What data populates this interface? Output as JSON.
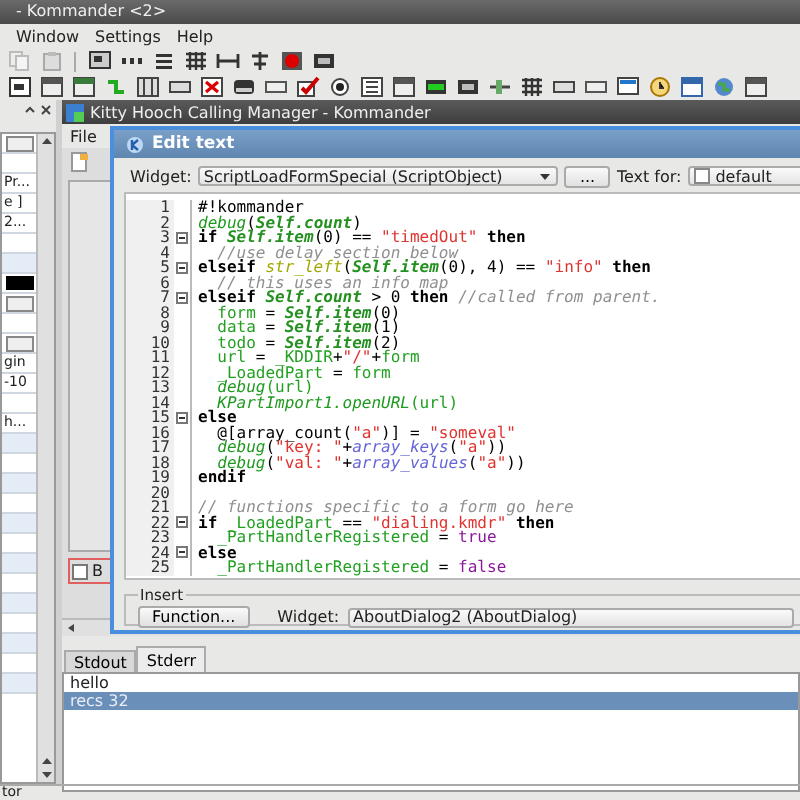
{
  "window": {
    "title": "- Kommander <2>"
  },
  "menu": [
    "Window",
    "Settings",
    "Help"
  ],
  "dock_panel": {
    "rows": [
      {
        "kind": "field"
      },
      {
        "kind": "blank"
      },
      {
        "kind": "text",
        "text": "Pr..."
      },
      {
        "kind": "text",
        "text": "e ]"
      },
      {
        "kind": "text",
        "text": "2..."
      },
      {
        "kind": "blank"
      },
      {
        "kind": "shaded"
      },
      {
        "kind": "black"
      },
      {
        "kind": "field"
      },
      {
        "kind": "blank"
      },
      {
        "kind": "field"
      },
      {
        "kind": "text",
        "text": "gin"
      },
      {
        "kind": "text",
        "text": "-10"
      },
      {
        "kind": "blank"
      },
      {
        "kind": "text",
        "text": "h..."
      },
      {
        "kind": "shaded"
      },
      {
        "kind": "blank"
      },
      {
        "kind": "shaded"
      },
      {
        "kind": "blank"
      },
      {
        "kind": "shaded"
      },
      {
        "kind": "blank"
      },
      {
        "kind": "shaded"
      },
      {
        "kind": "blank"
      },
      {
        "kind": "shaded"
      },
      {
        "kind": "blank"
      },
      {
        "kind": "shaded"
      },
      {
        "kind": "blank"
      },
      {
        "kind": "shaded"
      }
    ]
  },
  "inner_window": {
    "title": "Kitty Hooch Calling Manager - Kommander",
    "menu": [
      "File"
    ],
    "checkbox": {
      "label": "B",
      "checked": false
    }
  },
  "dialog": {
    "title": "Edit text",
    "widget_label": "Widget:",
    "widget_value": "ScriptLoadFormSpecial (ScriptObject)",
    "browse_button": "...",
    "text_for_label": "Text for:",
    "text_for_value": "default",
    "code_lines": [
      {
        "number": "1",
        "fold": false,
        "tokens": [
          {
            "kind": "plain",
            "text": "#!kommander"
          }
        ]
      },
      {
        "number": "2",
        "fold": false,
        "tokens": [
          {
            "kind": "func",
            "text": "debug"
          },
          {
            "kind": "plain",
            "text": "("
          },
          {
            "kind": "self",
            "text": "Self.count"
          },
          {
            "kind": "plain",
            "text": ")"
          }
        ]
      },
      {
        "number": "3",
        "fold": true,
        "tokens": [
          {
            "kind": "keyword",
            "text": "if"
          },
          {
            "kind": "self",
            "text": " Self.item"
          },
          {
            "kind": "plain",
            "text": "(0) == "
          },
          {
            "kind": "string",
            "text": "\"timedOut\""
          },
          {
            "kind": "keyword",
            "text": " then"
          }
        ]
      },
      {
        "number": "4",
        "fold": false,
        "tokens": [
          {
            "kind": "comment",
            "text": "  //use delay section below"
          }
        ]
      },
      {
        "number": "5",
        "fold": true,
        "tokens": [
          {
            "kind": "keyword",
            "text": "elseif"
          },
          {
            "kind": "strfunc",
            "text": " str_left"
          },
          {
            "kind": "plain",
            "text": "("
          },
          {
            "kind": "self",
            "text": "Self.item"
          },
          {
            "kind": "plain",
            "text": "(0), 4) == "
          },
          {
            "kind": "string",
            "text": "\"info\""
          },
          {
            "kind": "keyword",
            "text": " then"
          }
        ]
      },
      {
        "number": "6",
        "fold": false,
        "tokens": [
          {
            "kind": "comment",
            "text": "  // this uses an info map"
          }
        ]
      },
      {
        "number": "7",
        "fold": true,
        "tokens": [
          {
            "kind": "keyword",
            "text": "elseif"
          },
          {
            "kind": "self",
            "text": " Self.count"
          },
          {
            "kind": "plain",
            "text": " > 0 "
          },
          {
            "kind": "keyword",
            "text": "then"
          },
          {
            "kind": "comment",
            "text": " //called from parent."
          }
        ]
      },
      {
        "number": "8",
        "fold": false,
        "tokens": [
          {
            "kind": "var",
            "text": "  form"
          },
          {
            "kind": "plain",
            "text": " = "
          },
          {
            "kind": "self",
            "text": "Self.item"
          },
          {
            "kind": "plain",
            "text": "(0)"
          }
        ]
      },
      {
        "number": "9",
        "fold": false,
        "tokens": [
          {
            "kind": "var",
            "text": "  data"
          },
          {
            "kind": "plain",
            "text": " = "
          },
          {
            "kind": "self",
            "text": "Self.item"
          },
          {
            "kind": "plain",
            "text": "(1)"
          }
        ]
      },
      {
        "number": "10",
        "fold": false,
        "tokens": [
          {
            "kind": "var",
            "text": "  todo"
          },
          {
            "kind": "plain",
            "text": " = "
          },
          {
            "kind": "self",
            "text": "Self.item"
          },
          {
            "kind": "plain",
            "text": "(2)"
          }
        ]
      },
      {
        "number": "11",
        "fold": false,
        "tokens": [
          {
            "kind": "var",
            "text": "  url"
          },
          {
            "kind": "plain",
            "text": " = "
          },
          {
            "kind": "var",
            "text": "_KDDIR"
          },
          {
            "kind": "plain",
            "text": "+"
          },
          {
            "kind": "string",
            "text": "\"/\""
          },
          {
            "kind": "plain",
            "text": "+"
          },
          {
            "kind": "var",
            "text": "form"
          }
        ]
      },
      {
        "number": "12",
        "fold": false,
        "tokens": [
          {
            "kind": "var",
            "text": "  _LoadedPart"
          },
          {
            "kind": "plain",
            "text": " = "
          },
          {
            "kind": "var",
            "text": "form"
          }
        ]
      },
      {
        "number": "13",
        "fold": false,
        "tokens": [
          {
            "kind": "func",
            "text": "  debug"
          },
          {
            "kind": "var",
            "text": "(url)"
          }
        ]
      },
      {
        "number": "14",
        "fold": false,
        "tokens": [
          {
            "kind": "func",
            "text": "  KPartImport1.openURL"
          },
          {
            "kind": "var",
            "text": "(url)"
          }
        ]
      },
      {
        "number": "15",
        "fold": true,
        "tokens": [
          {
            "kind": "keyword",
            "text": "else"
          }
        ]
      },
      {
        "number": "16",
        "fold": false,
        "tokens": [
          {
            "kind": "plain",
            "text": "  @[array_count("
          },
          {
            "kind": "string",
            "text": "\"a\""
          },
          {
            "kind": "plain",
            "text": ")] = "
          },
          {
            "kind": "string",
            "text": "\"someval\""
          }
        ]
      },
      {
        "number": "17",
        "fold": false,
        "tokens": [
          {
            "kind": "func",
            "text": "  debug"
          },
          {
            "kind": "plain",
            "text": "("
          },
          {
            "kind": "string",
            "text": "\"key: \""
          },
          {
            "kind": "plain",
            "text": "+"
          },
          {
            "kind": "array",
            "text": "array_keys"
          },
          {
            "kind": "plain",
            "text": "("
          },
          {
            "kind": "string",
            "text": "\"a\""
          },
          {
            "kind": "plain",
            "text": "))"
          }
        ]
      },
      {
        "number": "18",
        "fold": false,
        "tokens": [
          {
            "kind": "func",
            "text": "  debug"
          },
          {
            "kind": "plain",
            "text": "("
          },
          {
            "kind": "string",
            "text": "\"val: \""
          },
          {
            "kind": "plain",
            "text": "+"
          },
          {
            "kind": "array",
            "text": "array_values"
          },
          {
            "kind": "plain",
            "text": "("
          },
          {
            "kind": "string",
            "text": "\"a\""
          },
          {
            "kind": "plain",
            "text": "))"
          }
        ]
      },
      {
        "number": "19",
        "fold": false,
        "tokens": [
          {
            "kind": "keyword",
            "text": "endif"
          }
        ]
      },
      {
        "number": "20",
        "fold": false
      },
      {
        "number": "21",
        "fold": false,
        "tokens": [
          {
            "kind": "comment",
            "text": "// functions specific to a form go here"
          }
        ]
      },
      {
        "number": "22",
        "fold": true,
        "tokens": [
          {
            "kind": "keyword",
            "text": "if"
          },
          {
            "kind": "var",
            "text": " _LoadedPart"
          },
          {
            "kind": "plain",
            "text": " == "
          },
          {
            "kind": "string",
            "text": "\"dialing.kmdr\""
          },
          {
            "kind": "keyword",
            "text": " then"
          }
        ]
      },
      {
        "number": "23",
        "fold": false,
        "tokens": [
          {
            "kind": "var",
            "text": "  _PartHandlerRegistered"
          },
          {
            "kind": "plain",
            "text": " = "
          },
          {
            "kind": "bool",
            "text": "true"
          }
        ]
      },
      {
        "number": "24",
        "fold": true,
        "tokens": [
          {
            "kind": "keyword",
            "text": "else"
          }
        ]
      },
      {
        "number": "25",
        "fold": false,
        "tokens": [
          {
            "kind": "var",
            "text": "  _PartHandlerRegistered"
          },
          {
            "kind": "plain",
            "text": " = "
          },
          {
            "kind": "bool",
            "text": "false"
          }
        ]
      }
    ],
    "insert": {
      "legend": "Insert",
      "function_button": "Function...",
      "widget_label": "Widget:",
      "widget_value": "AboutDialog2 (AboutDialog)"
    }
  },
  "output_tabs": [
    {
      "label": "Stdout",
      "selected": false
    },
    {
      "label": "Stderr",
      "selected": true
    }
  ],
  "output_lines": [
    {
      "text": "hello",
      "selected": false
    },
    {
      "text": "recs 32",
      "selected": true
    }
  ],
  "status_bar": "tor"
}
